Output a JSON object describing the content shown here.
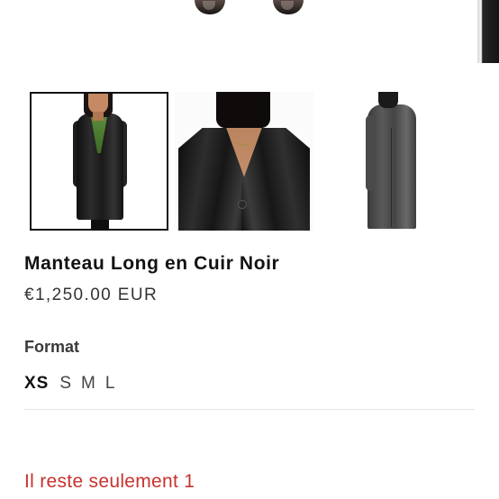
{
  "product": {
    "title": "Manteau Long en Cuir Noir",
    "price": "€1,250.00 EUR",
    "format_label": "Format",
    "sizes": [
      "XS",
      "S",
      "M",
      "L"
    ],
    "selected_size": "XS",
    "stock_message": "Il reste seulement 1"
  },
  "gallery": {
    "thumbnails": [
      {
        "name": "front full view",
        "selected": true
      },
      {
        "name": "close-up view",
        "selected": false
      },
      {
        "name": "back view",
        "selected": false
      }
    ]
  },
  "colors": {
    "stock_text": "#c8322f",
    "title_text": "#121212",
    "selected_border": "#111111"
  }
}
